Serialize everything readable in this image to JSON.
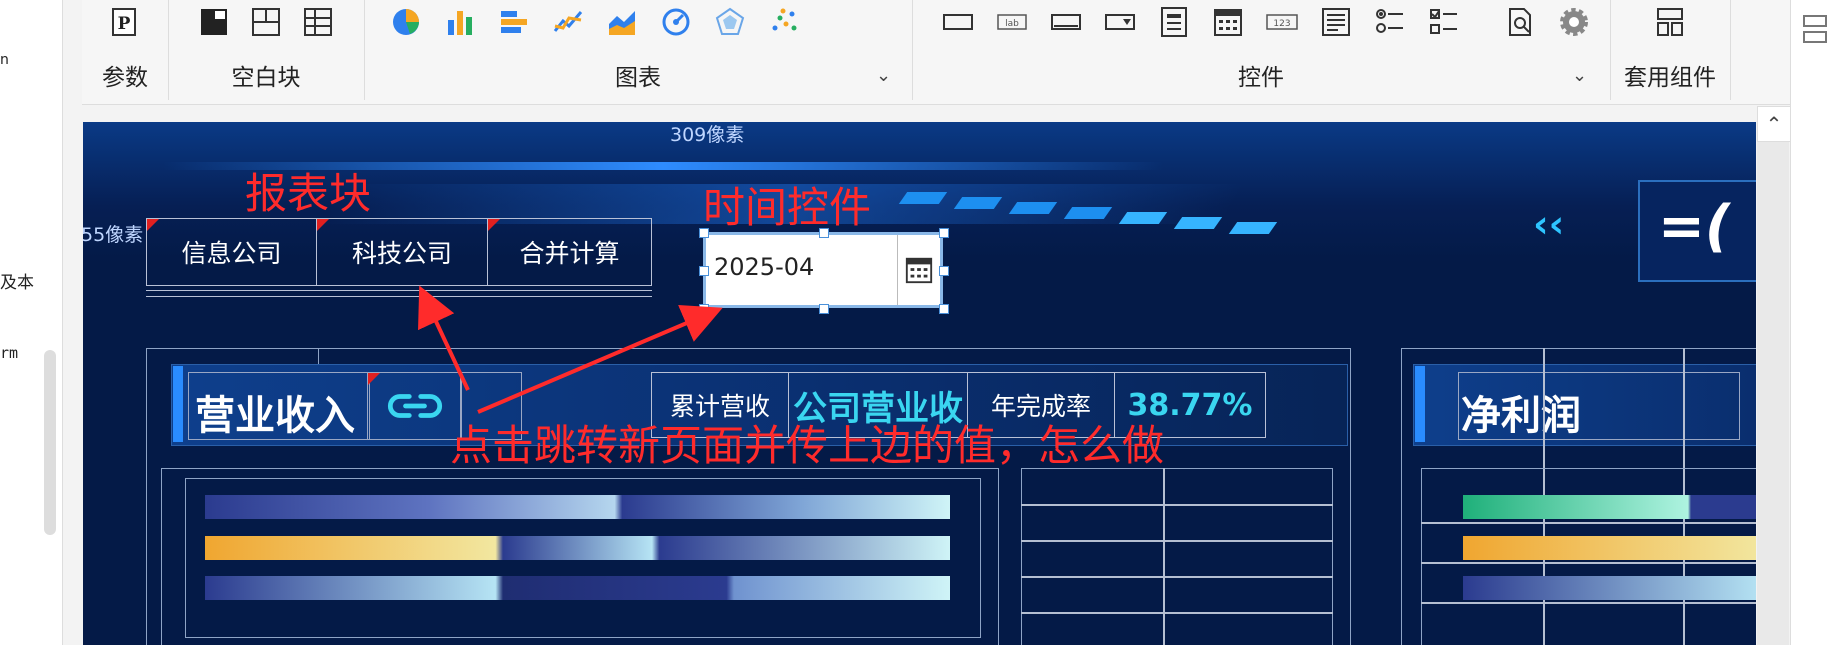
{
  "left_panel": {
    "fragments": [
      "n",
      "及本",
      "rm"
    ]
  },
  "toolbar": {
    "groups": [
      {
        "label": "参数"
      },
      {
        "label": "空白块"
      },
      {
        "label": "图表"
      },
      {
        "label": "控件"
      },
      {
        "label": "套用组件"
      }
    ],
    "icons": {
      "param": "param-icon",
      "blank": [
        "blank-block-icon",
        "split-block-icon",
        "table-block-icon"
      ],
      "chart": [
        "pie-chart-icon",
        "bar-chart-icon",
        "horizontal-bar-icon",
        "line-chart-icon",
        "area-chart-icon",
        "gauge-chart-icon",
        "radar-chart-icon",
        "scatter-chart-icon"
      ],
      "widget": [
        "text-box-icon",
        "label-icon",
        "button-icon",
        "dropdown-icon",
        "dropdown-tree-icon",
        "date-icon",
        "number-icon",
        "text-area-icon",
        "radio-group-icon",
        "checkbox-group-icon",
        "search-icon",
        "settings-icon"
      ],
      "suite": "layout-icon"
    },
    "lab_text": "lab",
    "num_text": "123"
  },
  "canvas": {
    "size_top": "309像素",
    "size_left": "55像素",
    "tabs": [
      "信息公司",
      "科技公司",
      "合并计算"
    ],
    "date_value": "2025-04",
    "revenue_title": "营业收入",
    "cumulative_label": "累计营收",
    "company_revenue": "公司营业收",
    "completion_label": "年完成率",
    "completion_value": "38.77%",
    "net_profit_title": "净利润",
    "big_title_fragment": "=("
  },
  "annotations": {
    "report_block": "报表块",
    "time_control": "时间控件",
    "question": "点击跳转新页面并传上边的值，怎么做"
  },
  "colors": {
    "canvas_bg": "#041a47",
    "annotation_red": "#ff2b2b",
    "accent_cyan": "#3ad6f0"
  }
}
